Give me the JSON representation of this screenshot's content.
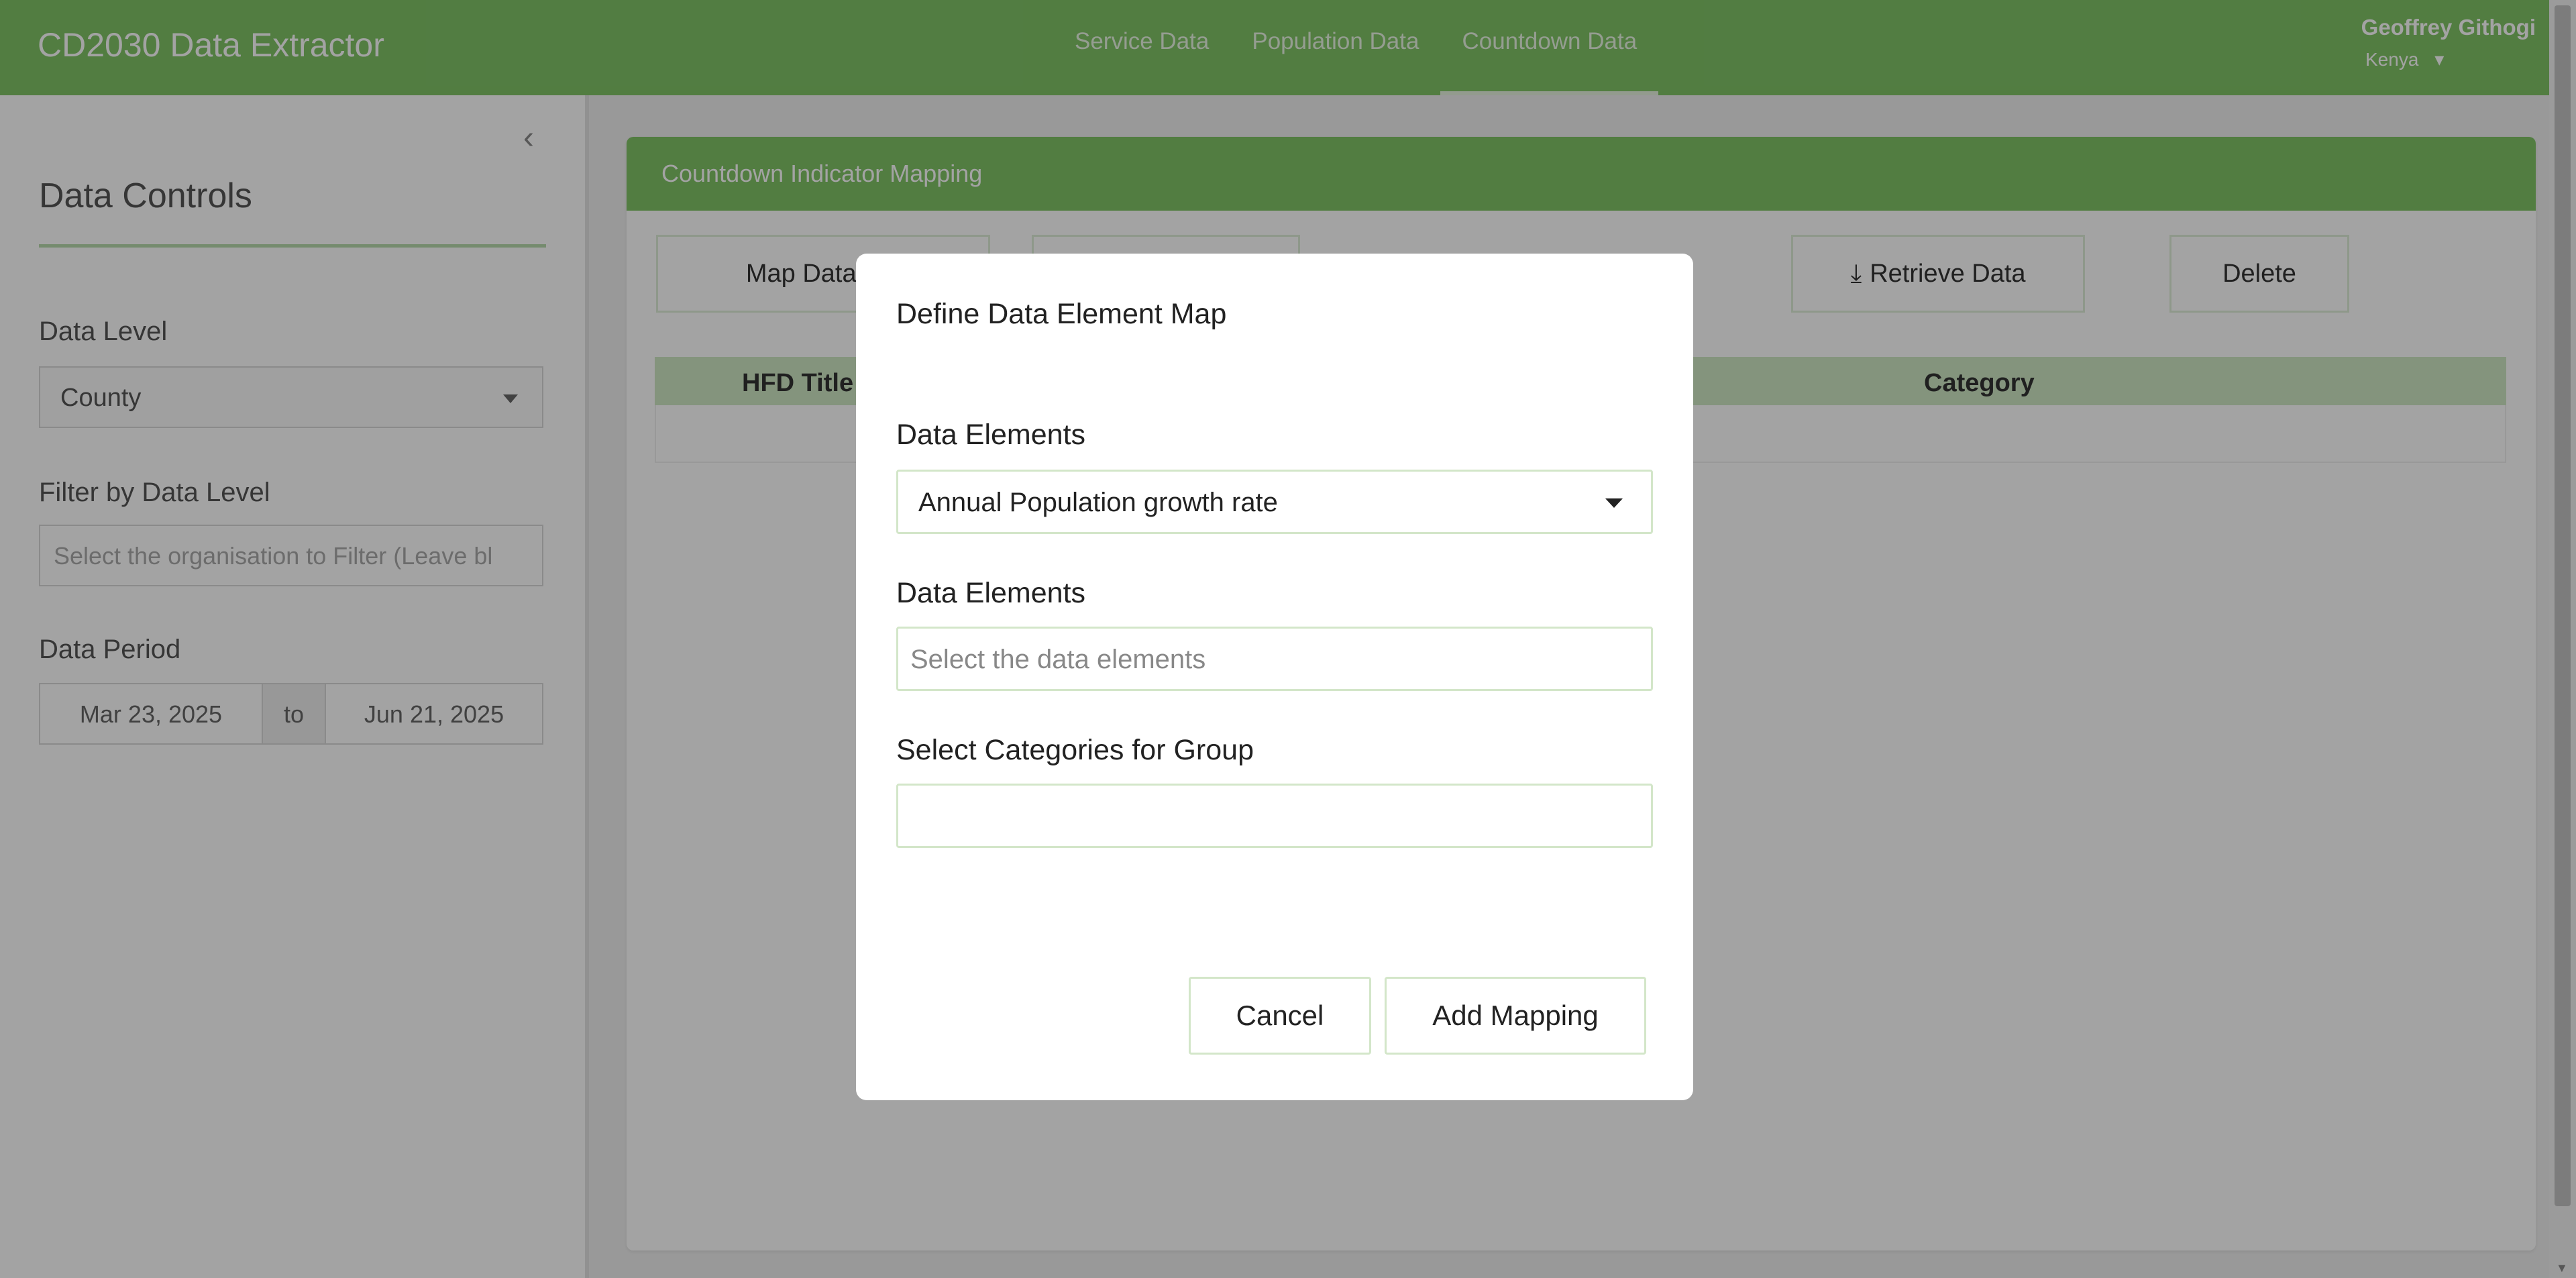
{
  "header": {
    "app_title": "CD2030 Data Extractor",
    "nav": [
      {
        "label": "Service Data"
      },
      {
        "label": "Population Data"
      },
      {
        "label": "Countdown Data"
      }
    ],
    "user": {
      "name": "Geoffrey Githogi",
      "country": "Kenya"
    }
  },
  "sidebar": {
    "title": "Data Controls",
    "data_level_label": "Data Level",
    "data_level_value": "County",
    "filter_label": "Filter by Data Level",
    "filter_placeholder": "Select the organisation to Filter (Leave bl",
    "period_label": "Data Period",
    "period_from": "Mar 23, 2025",
    "period_separator": "to",
    "period_to": "Jun 21, 2025"
  },
  "main": {
    "card_title": "Countdown Indicator Mapping",
    "buttons": {
      "map": "Map Data Ele",
      "retrieve": "Retrieve Data",
      "delete": "Delete"
    },
    "table": {
      "col_title": "HFD Title",
      "col_category": "Category"
    }
  },
  "modal": {
    "title": "Define Data Element Map",
    "field1_label": "Data Elements",
    "field1_value": "Annual Population growth rate",
    "field2_label": "Data Elements",
    "field2_placeholder": "Select the data elements",
    "field3_label": "Select Categories for Group",
    "cancel_label": "Cancel",
    "add_label": "Add Mapping"
  },
  "colors": {
    "brand_green": "#80c467",
    "overlay": "rgba(0,0,0,0.36)"
  }
}
